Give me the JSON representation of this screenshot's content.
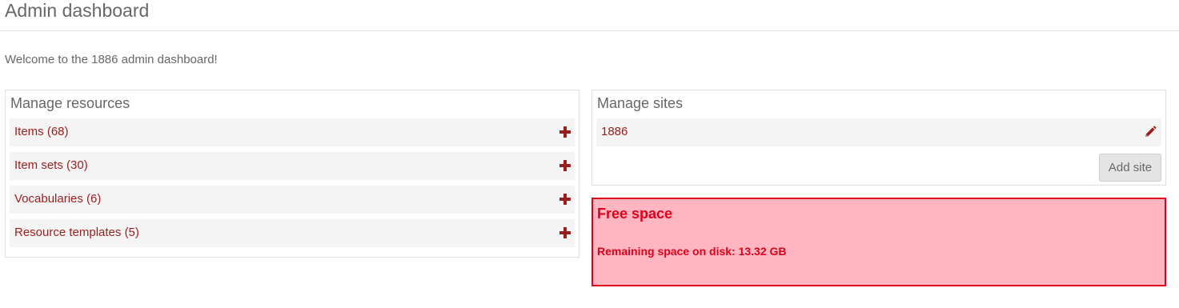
{
  "header": {
    "title": "Admin dashboard"
  },
  "welcome_text": "Welcome to the 1886 admin dashboard!",
  "manage_resources": {
    "title": "Manage resources",
    "items": [
      {
        "label": "Items (68)",
        "icon": "plus-icon"
      },
      {
        "label": "Item sets (30)",
        "icon": "plus-icon"
      },
      {
        "label": "Vocabularies (6)",
        "icon": "plus-icon"
      },
      {
        "label": "Resource templates (5)",
        "icon": "plus-icon"
      }
    ]
  },
  "manage_sites": {
    "title": "Manage sites",
    "sites": [
      {
        "label": "1886",
        "icon": "pencil-icon"
      }
    ],
    "add_site_label": "Add site"
  },
  "free_space": {
    "title": "Free space",
    "text": "Remaining space on disk: 13.32 GB"
  },
  "colors": {
    "link": "#9b1e1e",
    "text": "#676767",
    "alert_bg": "#ffb6c1",
    "alert_border": "#e0001b"
  }
}
